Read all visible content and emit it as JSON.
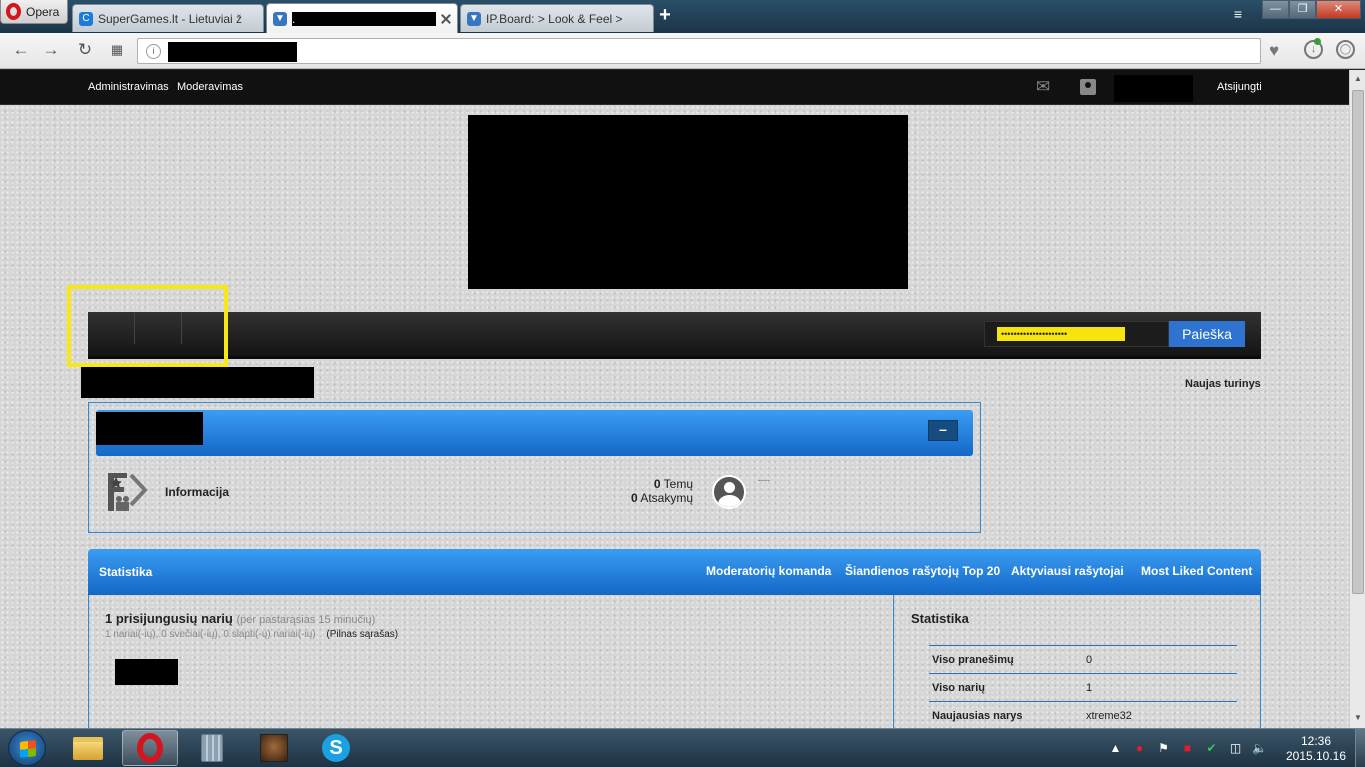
{
  "browser": {
    "menu_label": "Opera",
    "tabs": [
      {
        "title": "SuperGames.lt - Lietuviai ž"
      },
      {
        "title": "."
      },
      {
        "title": "IP.Board: > Look & Feel >"
      }
    ],
    "new_tab": "+",
    "window_controls": {
      "minimize": "—",
      "maximize": "❐",
      "close": "✕"
    }
  },
  "userbar": {
    "links": [
      "Administravimas",
      "Moderavimas"
    ],
    "logout": "Atsijungti"
  },
  "navbar": {
    "search_value": "•••••••••••••••••••••",
    "search_button": "Paieška"
  },
  "new_content": "Naujas turinys",
  "category": {
    "toggle": "–",
    "forum": {
      "name": "Informacija",
      "topics_count": "0",
      "topics_label": "Temų",
      "replies_count": "0",
      "replies_label": "Atsakymų",
      "last_post": "----"
    }
  },
  "statistics": {
    "title": "Statistika",
    "links": [
      "Moderatorių komanda",
      "Šiandienos rašytojų Top 20",
      "Aktyviausi rašytojai",
      "Most Liked Content"
    ],
    "online": {
      "title": "1 prisijungusių narių",
      "period": "(per pastarąsias 15 minučių)",
      "detail": "1 nariai(-ių), 0 svečiai(-ių), 0 slapti(-ų) nariai(-ių)",
      "full_list": "(Pilnas sąrašas)"
    },
    "sidebar": {
      "title": "Statistika",
      "rows": [
        {
          "key": "Viso pranešimų",
          "value": "0"
        },
        {
          "key": "Viso narių",
          "value": "1"
        },
        {
          "key": "Naujausias narys",
          "value": "xtreme32"
        }
      ]
    }
  },
  "taskbar": {
    "clock_time": "12:36",
    "clock_date": "2015.10.16"
  },
  "colors": {
    "accent_blue": "#2f73d0",
    "panel_blue": "#1468c6",
    "highlight_yellow": "#f7e714"
  }
}
